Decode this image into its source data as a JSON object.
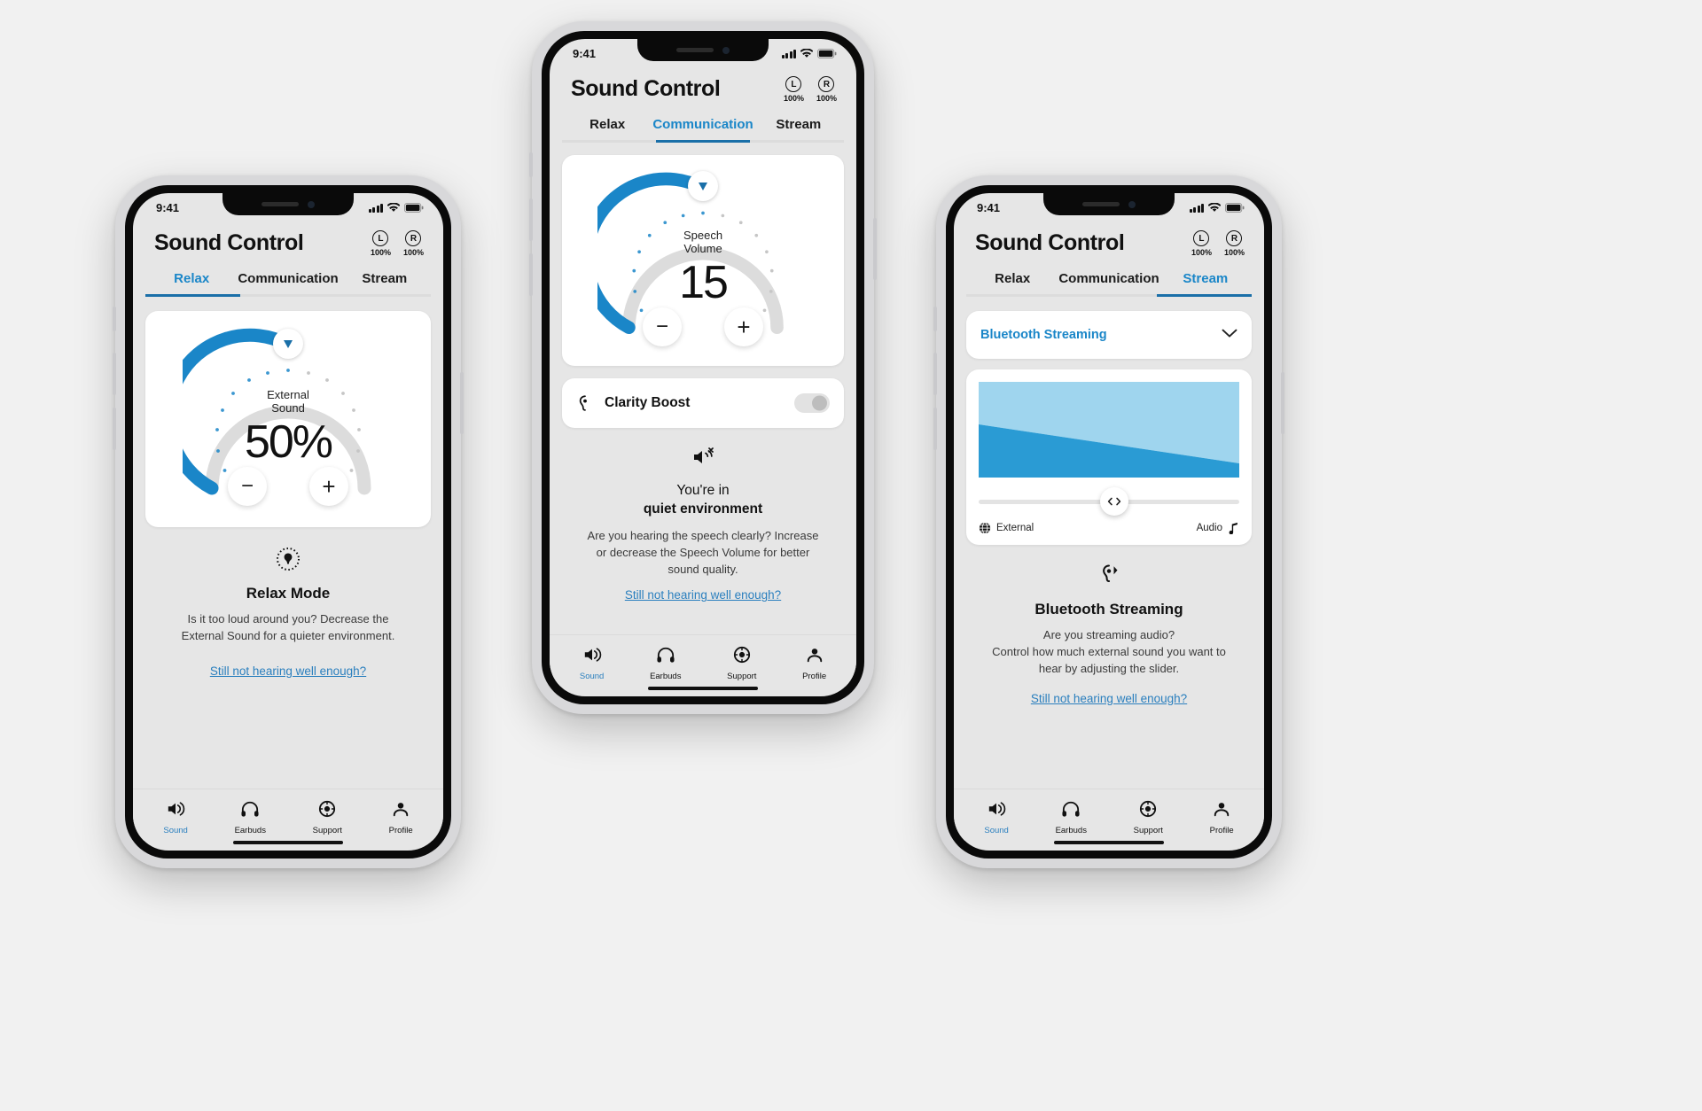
{
  "theme": {
    "accent": "#1a86c8",
    "accent_dark": "#1a6fa8",
    "link": "#2a7fbe",
    "track": "#dcdcdc",
    "screen_bg": "#e6e6e6",
    "card_bg": "#ffffff",
    "page_bg": "#f1f1f1",
    "graph_light": "#9fd5ee",
    "graph_dark": "#2a9bd4"
  },
  "phones": [
    {
      "id": "phone-relax",
      "status": {
        "time": "9:41",
        "signal_icon": "cellular-bars-icon",
        "wifi_icon": "wifi-icon",
        "battery_icon": "battery-full-icon"
      },
      "header": {
        "title": "Sound Control",
        "buds": [
          {
            "side": "L",
            "battery": "100%"
          },
          {
            "side": "R",
            "battery": "100%"
          }
        ]
      },
      "tabs": [
        {
          "label": "Relax",
          "active": true
        },
        {
          "label": "Communication",
          "active": false
        },
        {
          "label": "Stream",
          "active": false
        }
      ],
      "dial": {
        "label_line1": "External",
        "label_line2": "Sound",
        "value": "50%",
        "percent": 50,
        "minus_label": "−",
        "plus_label": "+"
      },
      "info": {
        "icon": "relax-mode-icon",
        "title": "Relax Mode",
        "desc_line1": "Is it too loud around you? Decrease the",
        "desc_line2": "External Sound for a quieter environment.",
        "link": "Still not hearing well enough?"
      },
      "nav": [
        {
          "label": "Sound",
          "icon": "speaker-icon",
          "active": true
        },
        {
          "label": "Earbuds",
          "icon": "headphones-icon",
          "active": false
        },
        {
          "label": "Support",
          "icon": "lifebuoy-icon",
          "active": false
        },
        {
          "label": "Profile",
          "icon": "person-icon",
          "active": false
        }
      ]
    },
    {
      "id": "phone-communication",
      "status": {
        "time": "9:41",
        "signal_icon": "cellular-bars-icon",
        "wifi_icon": "wifi-icon",
        "battery_icon": "battery-full-icon"
      },
      "header": {
        "title": "Sound Control",
        "buds": [
          {
            "side": "L",
            "battery": "100%"
          },
          {
            "side": "R",
            "battery": "100%"
          }
        ]
      },
      "tabs": [
        {
          "label": "Relax",
          "active": false
        },
        {
          "label": "Communication",
          "active": true
        },
        {
          "label": "Stream",
          "active": false
        }
      ],
      "dial": {
        "label_line1": "Speech",
        "label_line2": "Volume",
        "value": "15",
        "percent": 50,
        "minus_label": "−",
        "plus_label": "+"
      },
      "toggle": {
        "icon": "clarity-boost-icon",
        "label": "Clarity Boost",
        "state": "off"
      },
      "info": {
        "icon": "noisy-environment-icon",
        "title_line1": "You're in",
        "title_line2": "quiet environment",
        "desc_line1": "Are you hearing the speech clearly? Increase",
        "desc_line2": "or decrease the Speech Volume for better",
        "desc_line3": "sound quality.",
        "link": "Still not hearing well enough?"
      },
      "nav": [
        {
          "label": "Sound",
          "icon": "speaker-icon",
          "active": true
        },
        {
          "label": "Earbuds",
          "icon": "headphones-icon",
          "active": false
        },
        {
          "label": "Support",
          "icon": "lifebuoy-icon",
          "active": false
        },
        {
          "label": "Profile",
          "icon": "person-icon",
          "active": false
        }
      ]
    },
    {
      "id": "phone-stream",
      "status": {
        "time": "9:41",
        "signal_icon": "cellular-bars-icon",
        "wifi_icon": "wifi-icon",
        "battery_icon": "battery-full-icon"
      },
      "header": {
        "title": "Sound Control",
        "buds": [
          {
            "side": "L",
            "battery": "100%"
          },
          {
            "side": "R",
            "battery": "100%"
          }
        ]
      },
      "tabs": [
        {
          "label": "Relax",
          "active": false
        },
        {
          "label": "Communication",
          "active": false
        },
        {
          "label": "Stream",
          "active": true
        }
      ],
      "dropdown": {
        "value": "Bluetooth Streaming",
        "chevron_icon": "chevron-down-icon"
      },
      "mixer": {
        "slider_percent": 52,
        "thumb_icon": "left-right-arrows-icon",
        "left_label": "External",
        "left_icon": "globe-icon",
        "right_label": "Audio",
        "right_icon": "music-note-icon"
      },
      "info": {
        "icon": "bluetooth-stream-icon",
        "title": "Bluetooth Streaming",
        "desc_line1": "Are you streaming audio?",
        "desc_line2": "Control how much external sound you want to",
        "desc_line3": "hear by adjusting the slider.",
        "link": "Still not hearing well enough?"
      },
      "nav": [
        {
          "label": "Sound",
          "icon": "speaker-icon",
          "active": true
        },
        {
          "label": "Earbuds",
          "icon": "headphones-icon",
          "active": false
        },
        {
          "label": "Support",
          "icon": "lifebuoy-icon",
          "active": false
        },
        {
          "label": "Profile",
          "icon": "person-icon",
          "active": false
        }
      ]
    }
  ]
}
